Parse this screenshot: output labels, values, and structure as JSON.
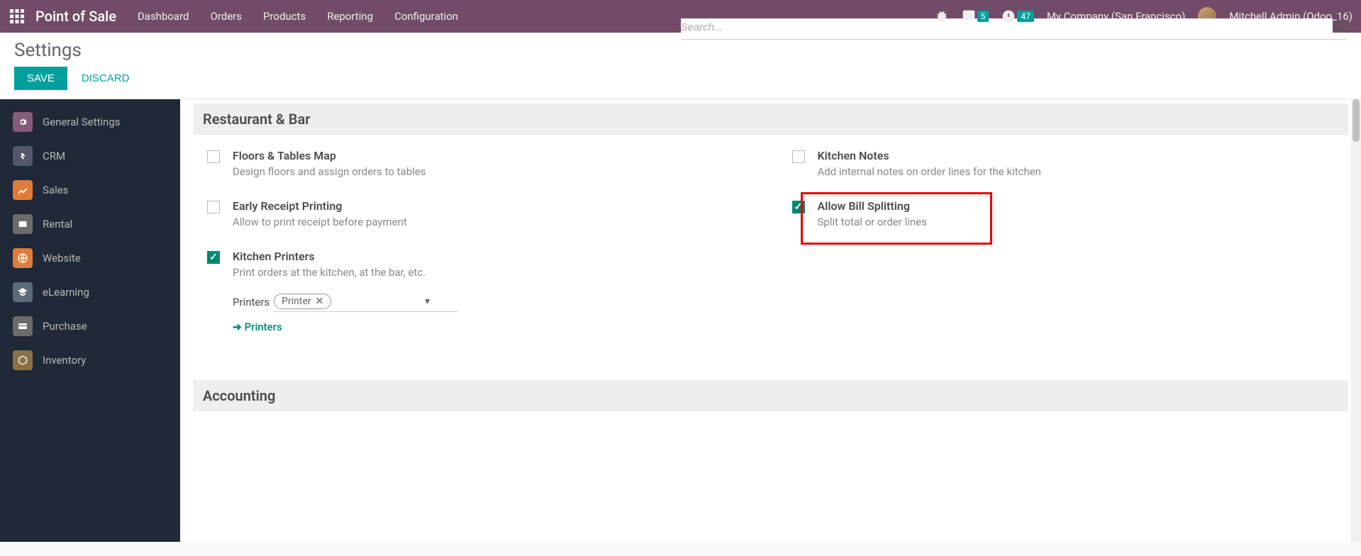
{
  "navbar": {
    "app_title": "Point of Sale",
    "menu": [
      "Dashboard",
      "Orders",
      "Products",
      "Reporting",
      "Configuration"
    ],
    "msg_badge": "5",
    "activity_badge": "47",
    "company": "My Company (San Francisco)",
    "user": "Mitchell Admin (Odoo_16)"
  },
  "cp": {
    "title": "Settings",
    "save": "SAVE",
    "discard": "DISCARD",
    "search_placeholder": "Search..."
  },
  "sidebar": {
    "items": [
      {
        "label": "General Settings",
        "color": "#875A7B"
      },
      {
        "label": "CRM",
        "color": "#54576b"
      },
      {
        "label": "Sales",
        "color": "#e07b39"
      },
      {
        "label": "Rental",
        "color": "#6b6b6b"
      },
      {
        "label": "Website",
        "color": "#e07b39"
      },
      {
        "label": "eLearning",
        "color": "#5b6b7a"
      },
      {
        "label": "Purchase",
        "color": "#6b6b6b"
      },
      {
        "label": "Inventory",
        "color": "#8b6f47"
      }
    ]
  },
  "sections": {
    "restaurant": {
      "header": "Restaurant & Bar",
      "floors": {
        "title": "Floors & Tables Map",
        "desc": "Design floors and assign orders to tables"
      },
      "kitchen_notes": {
        "title": "Kitchen Notes",
        "desc": "Add internal notes on order lines for the kitchen"
      },
      "early_receipt": {
        "title": "Early Receipt Printing",
        "desc": "Allow to print receipt before payment"
      },
      "bill_split": {
        "title": "Allow Bill Splitting",
        "desc": "Split total or order lines"
      },
      "kitchen_printers": {
        "title": "Kitchen Printers",
        "desc": "Print orders at the kitchen, at the bar, etc.",
        "field_label": "Printers",
        "tag": "Printer",
        "link": "Printers"
      }
    },
    "accounting": {
      "header": "Accounting"
    }
  }
}
